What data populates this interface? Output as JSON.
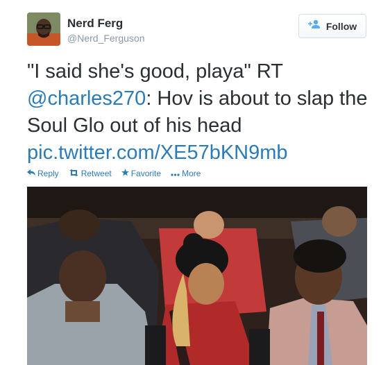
{
  "user": {
    "display_name": "Nerd Ferg",
    "screen_name": "@Nerd_Ferguson"
  },
  "follow_button": {
    "label": "Follow",
    "icon": "add-user-icon"
  },
  "tweet": {
    "text_part1": "\"I said she's good, playa\" RT ",
    "mention": "@charles270",
    "text_part2": ": Hov is about to slap the Soul Glo out of his head ",
    "link": "pic.twitter.com/XE57bKN9mb"
  },
  "actions": [
    {
      "label": "Reply",
      "icon": "reply-icon"
    },
    {
      "label": "Retweet",
      "icon": "retweet-icon"
    },
    {
      "label": "Favorite",
      "icon": "star-icon"
    },
    {
      "label": "More",
      "icon": "more-dots-icon"
    }
  ],
  "colors": {
    "link": "#2b7bb9",
    "text": "#292f33",
    "muted": "#8899a6"
  }
}
